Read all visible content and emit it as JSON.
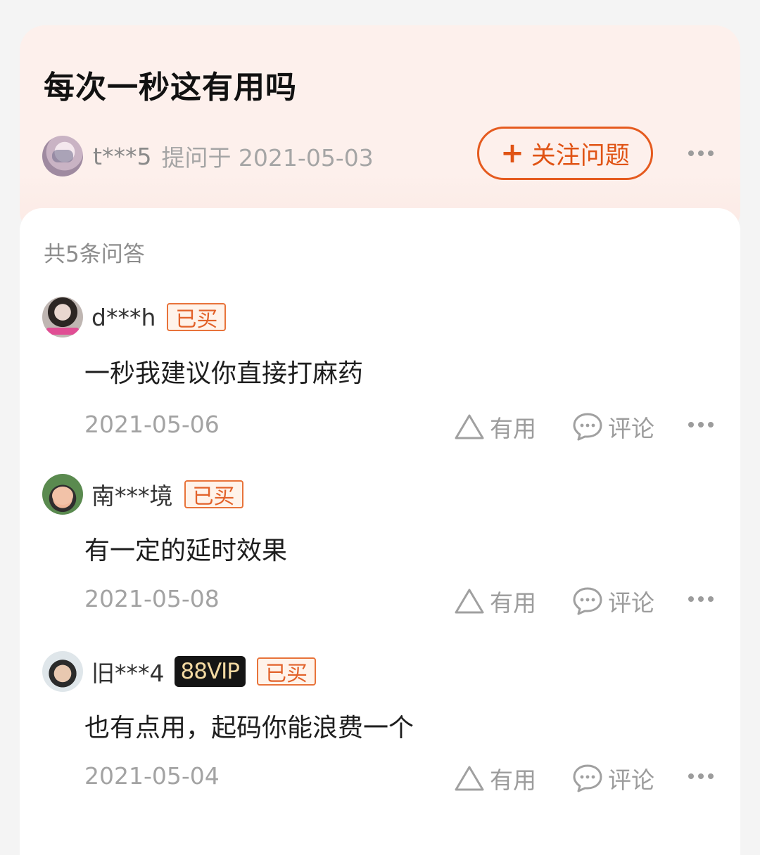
{
  "question": {
    "title": "每次一秒这有用吗",
    "asker": "t***5",
    "asked_text": "提问于 2021-05-03",
    "follow_button": "关注问题",
    "follow_icon": "+"
  },
  "answers_count": "共5条问答",
  "answers": [
    {
      "user": "d***h",
      "badges": {
        "bought": "已买"
      },
      "text": "一秒我建议你直接打麻药",
      "date": "2021-05-06",
      "useful_label": "有用",
      "comment_label": "评论"
    },
    {
      "user": "南***境",
      "badges": {
        "bought": "已买"
      },
      "text": "有一定的延时效果",
      "date": "2021-05-08",
      "useful_label": "有用",
      "comment_label": "评论"
    },
    {
      "user": "旧***4",
      "badges": {
        "vip": "88VIP",
        "bought": "已买"
      },
      "text": "也有点用，起码你能浪费一个",
      "date": "2021-05-04",
      "useful_label": "有用",
      "comment_label": "评论"
    }
  ],
  "colors": {
    "accent": "#e55b1f",
    "header_bg": "#fdf0ec",
    "vip_bg": "#151515",
    "vip_text": "#f3d9a2"
  }
}
